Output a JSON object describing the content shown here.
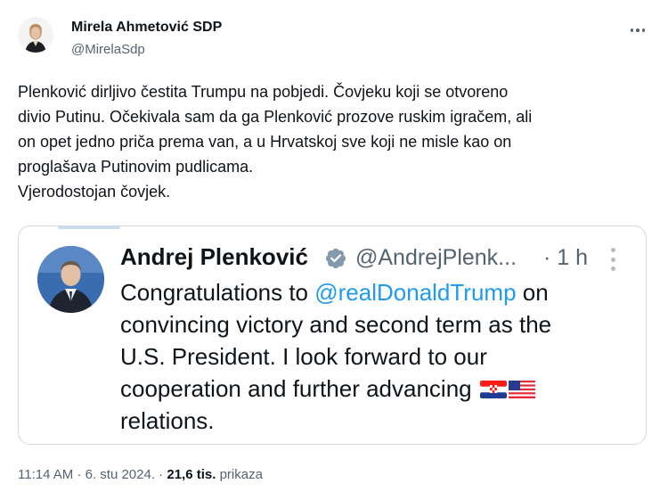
{
  "author": {
    "name": "Mirela Ahmetović SDP",
    "handle": "@MirelaSdp"
  },
  "tweet": {
    "lines": [
      "Plenković dirljivo čestita Trumpu na pobjedi. Čovjeku koji se otvoreno",
      "divio Putinu. Očekivala sam da ga Plenković prozove ruskim igračem, ali",
      "on opet jedno priča prema van, a u Hrvatskoj sve koji ne misle kao on",
      "proglašava Putinovim pudlicama.",
      "Vjerodostojan čovjek."
    ]
  },
  "quote": {
    "name": "Andrej Plenković",
    "handle": "@AndrejPlenk...",
    "time": "· 1 h",
    "text": {
      "line1_prefix": "Congratulations to ",
      "mention": "@realDonaldTrump",
      "line1_suffix": " on",
      "line2": "convincing victory and second term as the",
      "line3": "U.S. President. I look forward to our",
      "line4": "cooperation and further advancing",
      "line5": "relations."
    }
  },
  "meta": {
    "time": "11:14 AM",
    "sep1": " · ",
    "date": "6. stu 2024.",
    "sep2": " · ",
    "views_count": "21,6 tis.",
    "views_label": " prikaza"
  },
  "colors": {
    "accent": "#1d9bf0",
    "text": "#0f1419",
    "secondary": "#536471",
    "border": "#cfd9de"
  },
  "icons": [
    "more-dots-icon",
    "verified-badge-icon",
    "croatia-flag-icon",
    "usa-flag-icon"
  ]
}
